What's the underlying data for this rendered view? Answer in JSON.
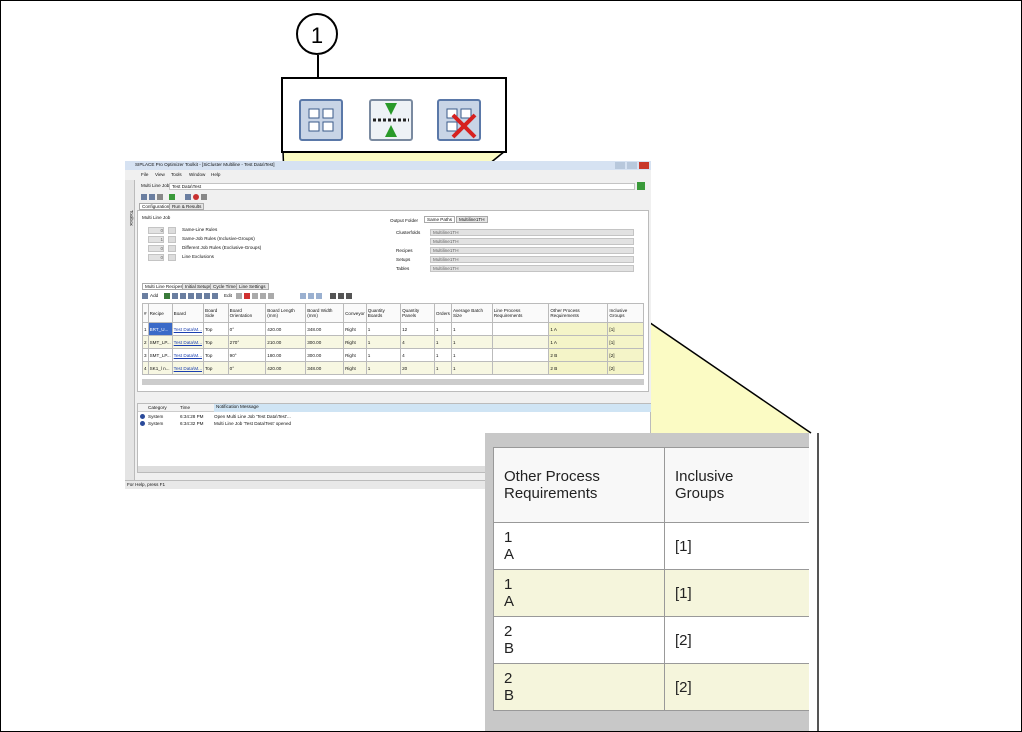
{
  "callout": {
    "number": "1"
  },
  "zoom_icons": [
    "grid-icon",
    "merge-arrows-icon",
    "grid-delete-icon"
  ],
  "app": {
    "title": "SIPLACE Pro Optimizer Toolkit - [SiCluster Multiline - Test Data\\Test]",
    "menu": [
      "File",
      "View",
      "Tools",
      "Window",
      "Help"
    ],
    "job_label": "Multi Line Job:",
    "job_value": "Test Data\\Test",
    "tabs_top": [
      "Configuration",
      "Run & Results"
    ],
    "section_label": "Multi Line Job",
    "rules": [
      {
        "count": "0",
        "label": "Same-Line Rules"
      },
      {
        "count": "1",
        "label": "Same-Job Rules (Inclusive-Groups)"
      },
      {
        "count": "0",
        "label": "Different Job Rules (Exclusive-Groups)"
      },
      {
        "count": "0",
        "label": "Line Exclusions"
      }
    ],
    "output_label": "Output Folder",
    "output_tab_1": "Same Paths",
    "output_tab_2": "Multiline1TH",
    "output_rows": [
      {
        "label": "Clusterfolds",
        "value": "Multiline1TH"
      },
      {
        "label": "",
        "value": "Multiline1TH"
      },
      {
        "label": "Recipes",
        "value": "Multiline1TH"
      },
      {
        "label": "Setups",
        "value": "Multiline1TH"
      },
      {
        "label": "Tables",
        "value": "Multiline1TH"
      }
    ],
    "sub_tabs": [
      "Multi Line Recipes",
      "Initial Setups",
      "Cycle Times",
      "Line Settings"
    ],
    "toolbar": {
      "add": "Add",
      "edit": "Edit"
    },
    "columns": [
      "#",
      "Recipe",
      "Board",
      "Board Side",
      "Board Orientation",
      "Board Length (mm)",
      "Board Width (mm)",
      "Conveyor",
      "Quantity Boards",
      "Quantity Panels",
      "Orders",
      "Average Batch Size",
      "Line Process Requirements",
      "Other Process Requirements",
      "Inclusive Groups"
    ],
    "rows": [
      {
        "n": "1",
        "recipe": "BRT_U...",
        "board": "Test Data\\M...",
        "side": "Top",
        "orient": "0°",
        "length": "420.00",
        "width": "348.00",
        "conveyor": "Right",
        "qb": "1",
        "qp": "12",
        "orders": "1",
        "batch": "1",
        "other": "1 A",
        "groups": "[1]"
      },
      {
        "n": "2",
        "recipe": "SMT_LP...",
        "board": "Test Data\\M...",
        "side": "Top",
        "orient": "270°",
        "length": "210.00",
        "width": "300.00",
        "conveyor": "Right",
        "qb": "1",
        "qp": "4",
        "orders": "1",
        "batch": "1",
        "other": "1 A",
        "groups": "[1]"
      },
      {
        "n": "3",
        "recipe": "SMT_LP...",
        "board": "Test Data\\M...",
        "side": "Top",
        "orient": "90°",
        "length": "180.00",
        "width": "300.00",
        "conveyor": "Right",
        "qb": "1",
        "qp": "4",
        "orders": "1",
        "batch": "1",
        "other": "2 B",
        "groups": "[2]"
      },
      {
        "n": "4",
        "recipe": "SK1_l n...",
        "board": "Test Data\\M...",
        "side": "Top",
        "orient": "0°",
        "length": "420.00",
        "width": "348.00",
        "conveyor": "Right",
        "qb": "1",
        "qp": "20",
        "orders": "1",
        "batch": "1",
        "other": "2 B",
        "groups": "[2]"
      }
    ],
    "notif_headers": [
      "Category",
      "Time",
      "Notification Message"
    ],
    "notifications": [
      {
        "category": "System",
        "time": "6:34:28 PM",
        "message": "Open Multi Line Job 'Test Data\\Test'..."
      },
      {
        "category": "System",
        "time": "6:34:32 PM",
        "message": "Multi Line Job 'Test Data\\Test' opened"
      }
    ],
    "status": "For Help, press F1",
    "sidebar_label": "Toolbox"
  },
  "zoom_table": {
    "header_1": [
      "Other Process",
      "Requirements"
    ],
    "header_2": [
      "Inclusive",
      "Groups"
    ],
    "rows": [
      {
        "req": [
          "1",
          "A"
        ],
        "group": "[1]"
      },
      {
        "req": [
          "1",
          "A"
        ],
        "group": "[1]"
      },
      {
        "req": [
          "2",
          "B"
        ],
        "group": "[2]"
      },
      {
        "req": [
          "2",
          "B"
        ],
        "group": "[2]"
      }
    ]
  },
  "colors": {
    "highlight": "#f5f5c0",
    "link": "#1a3fb0"
  }
}
